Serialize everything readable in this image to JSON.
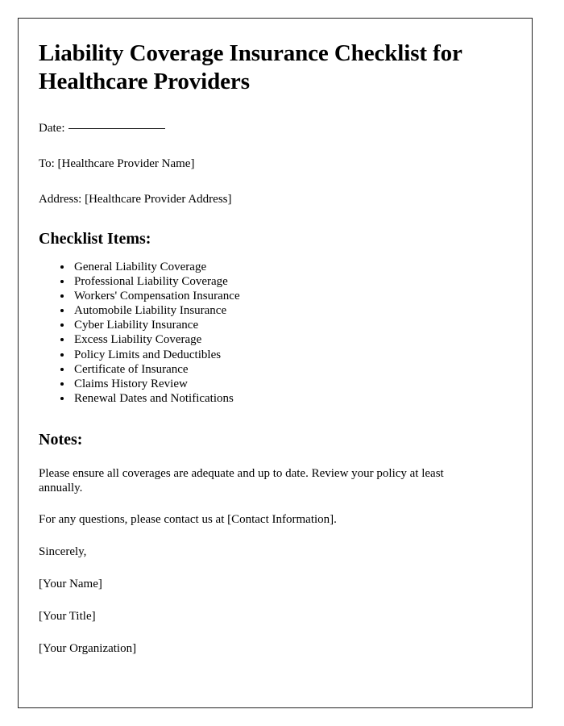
{
  "document": {
    "title": "Liability Coverage Insurance Checklist for Healthcare Providers",
    "fields": {
      "date_label": "Date:",
      "date_value": "",
      "to_line": "To: [Healthcare Provider Name]",
      "address_line": "Address: [Healthcare Provider Address]"
    },
    "checklist": {
      "heading": "Checklist Items:",
      "items": [
        "General Liability Coverage",
        "Professional Liability Coverage",
        "Workers' Compensation Insurance",
        "Automobile Liability Insurance",
        "Cyber Liability Insurance",
        "Excess Liability Coverage",
        "Policy Limits and Deductibles",
        "Certificate of Insurance",
        "Claims History Review",
        "Renewal Dates and Notifications"
      ]
    },
    "notes": {
      "heading": "Notes:",
      "paragraph_1": "Please ensure all coverages are adequate and up to date. Review your policy at least annually.",
      "paragraph_2": "For any questions, please contact us at [Contact Information]."
    },
    "closing": {
      "salutation": "Sincerely,",
      "name": "[Your Name]",
      "title": "[Your Title]",
      "organization": "[Your Organization]"
    }
  }
}
